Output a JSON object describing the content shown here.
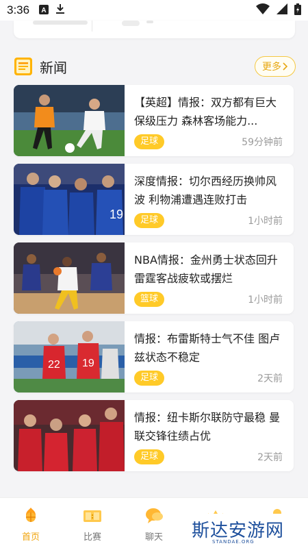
{
  "status_bar": {
    "time": "3:36"
  },
  "section": {
    "title": "新闻",
    "more_label": "更多",
    "accent": "#ffca28"
  },
  "news": [
    {
      "title": "【英超】情报：双方都有巨大保级压力 森林客场能力...",
      "tag": "足球",
      "time": "59分钟前",
      "thumb": "soccer-leeds-hull"
    },
    {
      "title": "深度情报：切尔西经历换帅风波 利物浦遭遇连败打击",
      "tag": "足球",
      "time": "1小时前",
      "thumb": "soccer-chelsea-celebration"
    },
    {
      "title": "NBA情报：金州勇士状态回升 雷霆客战疲软或摆烂",
      "tag": "篮球",
      "time": "1小时前",
      "thumb": "basketball-warriors"
    },
    {
      "title": "情报：布雷斯特士气不佳 图卢兹状态不稳定",
      "tag": "足球",
      "time": "2天前",
      "thumb": "soccer-brest"
    },
    {
      "title": "情报：纽卡斯尔联防守最稳 曼联交锋往绩占优",
      "tag": "足球",
      "time": "2天前",
      "thumb": "soccer-manutd"
    }
  ],
  "bottom_nav": [
    {
      "label": "首页",
      "icon": "home-basketball-icon",
      "active": true
    },
    {
      "label": "比赛",
      "icon": "scoreboard-icon",
      "active": false
    },
    {
      "label": "聊天",
      "icon": "chat-icon",
      "active": false
    },
    {
      "label": "",
      "icon": "crown-icon",
      "active": false
    },
    {
      "label": "",
      "icon": "profile-icon",
      "active": false
    }
  ],
  "watermark": {
    "main": "斯达安游网",
    "sub": "STANDAE.ORG"
  }
}
